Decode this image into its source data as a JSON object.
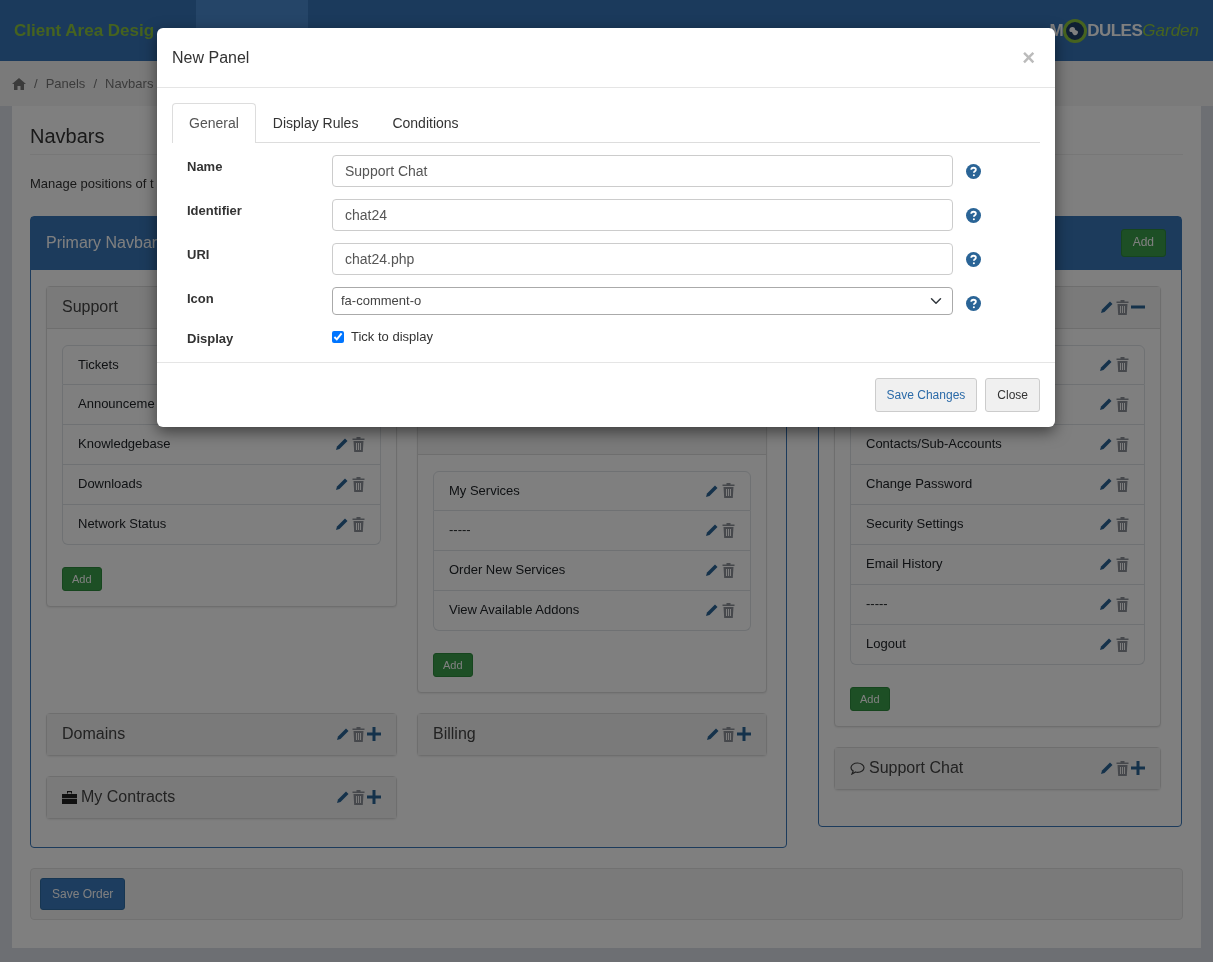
{
  "topbar": {
    "title": "Client Area Desig",
    "nav_tabs": [
      {
        "selected": true
      }
    ],
    "logo": {
      "lead": "M",
      "rest": "DULES",
      "tail": "Garden"
    }
  },
  "breadcrumb": {
    "separator": "/",
    "items": [
      "Panels",
      "Navbars"
    ]
  },
  "page": {
    "heading": "Navbars",
    "description": "Manage positions of t"
  },
  "primary_navbar": {
    "title": "Primary Navbar",
    "panels": [
      {
        "title": "Support",
        "actions": false,
        "items": [
          {
            "label": "Tickets",
            "actions": false
          },
          {
            "label": "Announceme",
            "actions": false
          },
          {
            "label": "Knowledgebase",
            "actions": true
          },
          {
            "label": "Downloads",
            "actions": true
          },
          {
            "label": "Network Status",
            "actions": true
          }
        ],
        "add_label": "Add"
      },
      {
        "actions": false,
        "items": [
          {
            "label": "My Services",
            "actions": true
          },
          {
            "label": "-----",
            "actions": true
          },
          {
            "label": "Order New Services",
            "actions": true
          },
          {
            "label": "View Available Addons",
            "actions": true
          }
        ],
        "add_label": "Add"
      },
      {
        "title": "Domains",
        "actions": true,
        "expanded": false
      },
      {
        "title": "Billing",
        "actions": true,
        "expanded": false
      },
      {
        "title": "My Contracts",
        "actions": true,
        "expanded": false
      }
    ]
  },
  "secondary_navbar": {
    "add_label": "Add",
    "panels": [
      {
        "actions": true,
        "expanded": true,
        "items": [
          {
            "actions": true
          },
          {
            "actions": true
          },
          {
            "label": "Contacts/Sub-Accounts",
            "actions": true
          },
          {
            "label": "Change Password",
            "actions": true
          },
          {
            "label": "Security Settings",
            "actions": true
          },
          {
            "label": "Email History",
            "actions": true
          },
          {
            "label": "-----",
            "actions": true
          },
          {
            "label": "Logout",
            "actions": true
          }
        ],
        "add_label": "Add"
      },
      {
        "title": "Support Chat",
        "actions": true,
        "expanded": false
      }
    ]
  },
  "save_label": "Save Order",
  "modal": {
    "title": "New Panel",
    "close": "×",
    "tabs": [
      {
        "label": "General",
        "selected": true
      },
      {
        "label": "Display Rules",
        "selected": false
      },
      {
        "label": "Conditions",
        "selected": false
      }
    ],
    "fields": [
      {
        "kind": "text",
        "label": "Name",
        "value": "Support Chat",
        "help": true
      },
      {
        "kind": "text",
        "label": "Identifier",
        "value": "chat24",
        "help": true
      },
      {
        "kind": "text",
        "label": "URI",
        "value": "chat24.php",
        "help": true
      },
      {
        "kind": "select",
        "label": "Icon",
        "value": "fa-comment-o",
        "help": true
      },
      {
        "kind": "checkbox",
        "label": "Display",
        "text": "Tick to display",
        "checked": true
      }
    ],
    "buttons": [
      {
        "label": "Save Changes",
        "kind": "primary"
      },
      {
        "label": "Close",
        "kind": "plain"
      }
    ]
  }
}
